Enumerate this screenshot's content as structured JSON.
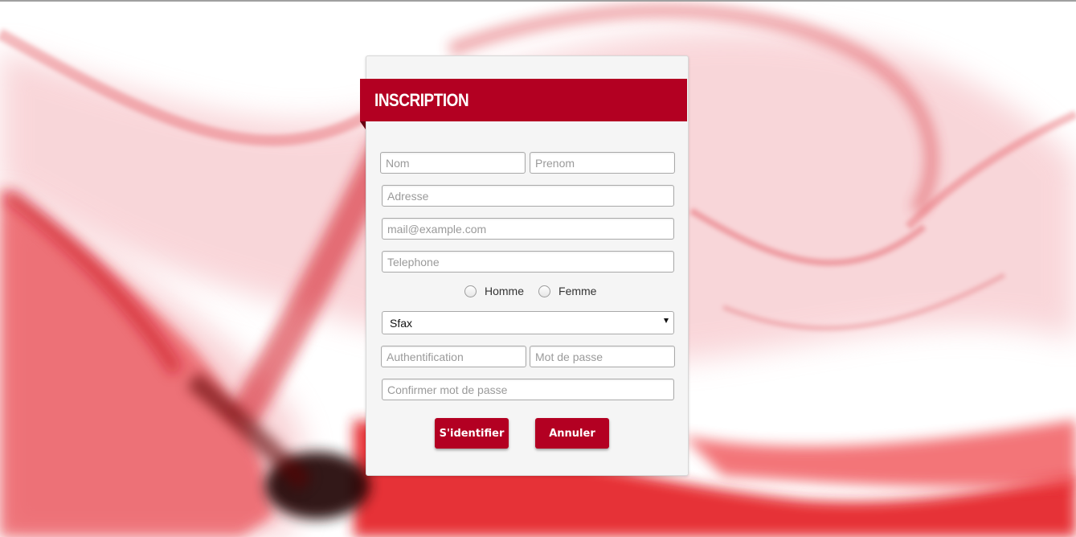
{
  "form": {
    "title": "INSCRIPTION",
    "nom": {
      "placeholder": "Nom",
      "value": ""
    },
    "prenom": {
      "placeholder": "Prenom",
      "value": ""
    },
    "adresse": {
      "placeholder": "Adresse",
      "value": ""
    },
    "email": {
      "placeholder": "mail@example.com",
      "value": ""
    },
    "telephone": {
      "placeholder": "Telephone",
      "value": ""
    },
    "gender": {
      "homme_label": "Homme",
      "femme_label": "Femme",
      "selected": ""
    },
    "city": {
      "selected": "Sfax"
    },
    "authentification": {
      "placeholder": "Authentification",
      "value": ""
    },
    "mot_de_passe": {
      "placeholder": "Mot de passe",
      "value": ""
    },
    "confirmer": {
      "placeholder": "Confirmer mot de passe",
      "value": ""
    },
    "buttons": {
      "submit_label": "S'identifier",
      "cancel_label": "Annuler"
    }
  },
  "colors": {
    "accent": "#b30022",
    "card_background": "#f5f5f5",
    "page_background": "#ffffff"
  },
  "background": {
    "image": "red-smoke-swirl"
  }
}
